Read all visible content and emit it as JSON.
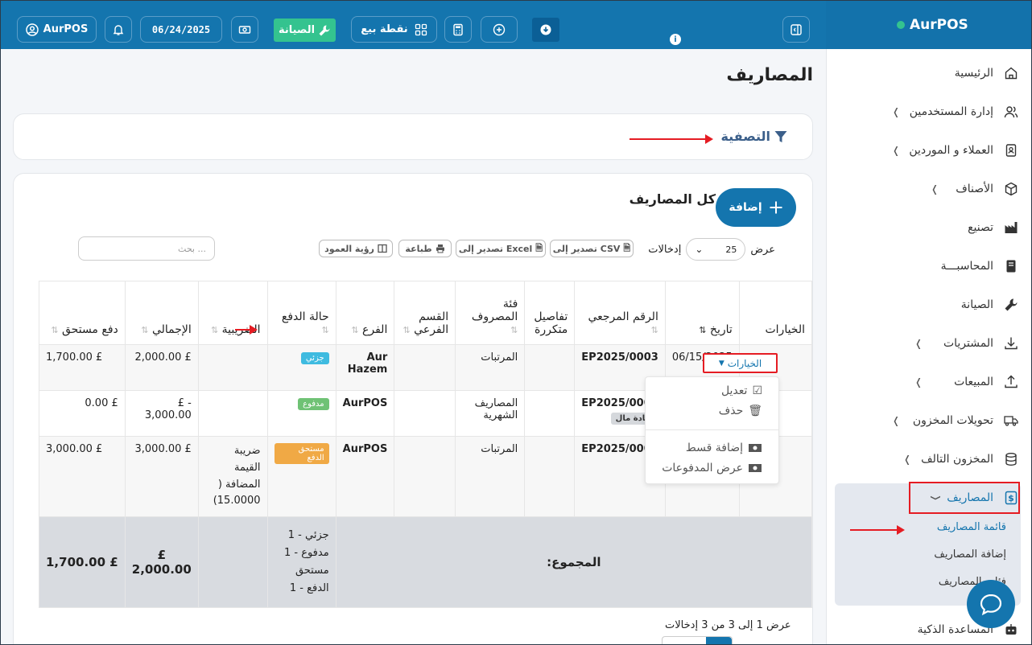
{
  "header": {
    "brand": "AurPOS",
    "user_label": "AurPOS",
    "date": "06/24/2025",
    "maintenance_label": "الصيانة",
    "pos_label": "نقطة بيع",
    "accent": "#1475ae"
  },
  "sidebar": {
    "items": [
      {
        "label": "الرئيسية"
      },
      {
        "label": "إدارة المستخدمين"
      },
      {
        "label": "العملاء و الموردين"
      },
      {
        "label": "الأصناف"
      },
      {
        "label": "تصنيع"
      },
      {
        "label": "المحاسبـــة"
      },
      {
        "label": "الصيانة"
      },
      {
        "label": "المشتريات"
      },
      {
        "label": "المبيعات"
      },
      {
        "label": "تحويلات المخزون"
      },
      {
        "label": "المخزون التالف"
      },
      {
        "label": "المصاريف"
      },
      {
        "label": "المساعدة الذكية"
      }
    ],
    "subitems": [
      {
        "label": "قائمة المصاريف"
      },
      {
        "label": "إضافة المصاريف"
      },
      {
        "label": "فئات المصاريف"
      }
    ]
  },
  "page": {
    "title": "المصاريف",
    "filter_label": "التصفية",
    "list_title": "كل المصاريف",
    "add_label": "إضافة",
    "show_label": "عرض",
    "entries_label": "إدخالات",
    "page_size": "25",
    "search_placeholder": "بحث ...",
    "export_csv": "تصدير إلى CSV",
    "export_excel": "تصدير إلى Excel",
    "print": "طباعة",
    "columns_visibility": "رؤية العمود",
    "footer_text": "عرض 1 إلى 3 من 3 إدخالات"
  },
  "table": {
    "headers": [
      "الخيارات",
      "تاريخ",
      "الرقم المرجعي",
      "تفاصيل متكررة",
      "فئة المصروف",
      "القسم الفرعي",
      "الفرع",
      "حالة الدفع",
      "الضريبية",
      "الإجمالي",
      "دفع مستحق"
    ],
    "rows": [
      {
        "date": "06/15/2025 07:57",
        "ref": "EP2025/0003",
        "ref_badge": "",
        "recurring": "",
        "category": "المرتبات",
        "subcategory": "",
        "branch": "Aur Hazem",
        "status": "جزئي",
        "tax": "",
        "total": "£ 2,000.00",
        "due": "£ 1,700.00"
      },
      {
        "date": "",
        "ref": "EP2025/0002",
        "ref_badge": "إعادة مال",
        "recurring": "",
        "category": "المصاريف الشهرية",
        "subcategory": "",
        "branch": "AurPOS",
        "status": "مدفوع",
        "tax": "",
        "total": "- £ 3,000.00",
        "due": "£ 0.00"
      },
      {
        "date": "",
        "ref": "EP2025/0001",
        "ref_badge": "",
        "recurring": "",
        "category": "المرتبات",
        "subcategory": "",
        "branch": "AurPOS",
        "status": "مستحق الدفع",
        "tax": "ضريبة القيمة المضافة ( 15.0000)",
        "total": "£ 3,000.00",
        "due": "£ 3,000.00"
      }
    ],
    "total_label": "المجموع:",
    "total_status": "جزئي - 1 مدفوع - 1 مستحق الدفع - 1",
    "total_amount": "£ 2,000.00",
    "total_due": "£ 1,700.00"
  },
  "options_menu": {
    "button_label": "الخيارات",
    "items": [
      {
        "label": "تعديل"
      },
      {
        "label": "حذف"
      },
      {
        "label": "إضافة قسط"
      },
      {
        "label": "عرض المدفوعات"
      }
    ]
  }
}
